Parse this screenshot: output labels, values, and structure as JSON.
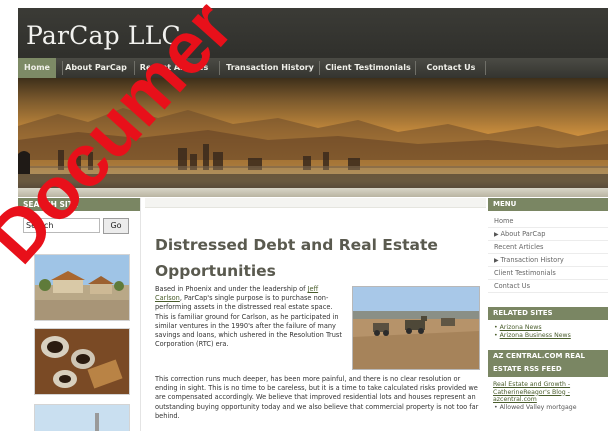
{
  "site": {
    "title": "ParCap LLC"
  },
  "nav": {
    "items": [
      {
        "label": "Home",
        "active": true
      },
      {
        "label": "About ParCap",
        "active": false
      },
      {
        "label": "Recent Articles",
        "active": false
      },
      {
        "label": "Transaction History",
        "active": false
      },
      {
        "label": "Client Testimonials",
        "active": false
      },
      {
        "label": "Contact Us",
        "active": false
      }
    ]
  },
  "search": {
    "heading": "SEARCH SITE",
    "input_value": "Search",
    "button_label": "Go"
  },
  "article": {
    "title": "Distressed Debt and Real Estate Opportunities",
    "para1_pre": "Based in Phoenix and under the leadership of ",
    "para1_link": "Jeff Carlson",
    "para1_post": ", ParCap's single purpose is to purchase non-performing assets in the distressed real estate space. This is familiar ground for Carlson, as he participated in similar ventures in the 1990's after the failure of many savings and loans, which ushered in the Resolution Trust Corporation (RTC) era.",
    "para2": "This correction runs much deeper, has been more painful, and there is no clear resolution or ending in sight. This is no time to be careless, but it is a time to take calculated risks provided we are compensated accordingly. We believe that improved residential lots and houses represent an outstanding buying opportunity today and we also believe that commercial property is not too far behind."
  },
  "menu": {
    "heading": "MENU",
    "items": [
      {
        "label": "Home",
        "arrow": false
      },
      {
        "label": "About ParCap",
        "arrow": true
      },
      {
        "label": "Recent Articles",
        "arrow": false
      },
      {
        "label": "Transaction History",
        "arrow": true
      },
      {
        "label": "Client Testimonials",
        "arrow": false
      },
      {
        "label": "Contact Us",
        "arrow": false
      }
    ]
  },
  "related": {
    "heading": "RELATED SITES",
    "items": [
      {
        "label": "Arizona News"
      },
      {
        "label": "Arizona Business News"
      }
    ]
  },
  "feed": {
    "heading": "AZ CENTRAL.COM REAL ESTATE RSS FEED",
    "link1": "Real Estate and Growth - CatherineReagor's Blog - azcentral.com",
    "bullet1": "Allowed Valley mortgage"
  },
  "watermark": {
    "text": "Documer"
  },
  "colors": {
    "nav_active": "#7d8a66",
    "box_head": "#7a8663",
    "link": "#4a5d2c",
    "watermark": "#e8101a"
  }
}
